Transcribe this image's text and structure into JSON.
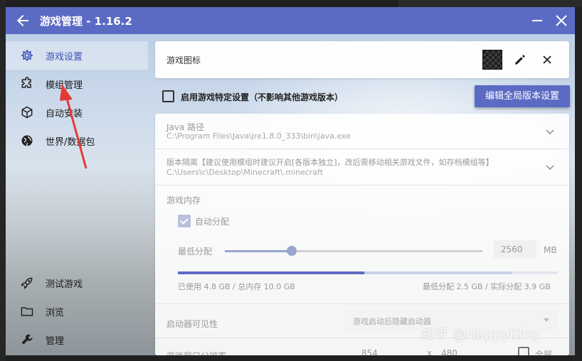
{
  "window": {
    "title": "游戏管理 - 1.16.2"
  },
  "sidebar": {
    "items": [
      {
        "label": "游戏设置",
        "icon": "gear-icon",
        "active": true
      },
      {
        "label": "模组管理",
        "icon": "puzzle-icon",
        "active": false
      },
      {
        "label": "自动安装",
        "icon": "package-icon",
        "active": false
      },
      {
        "label": "世界/数据包",
        "icon": "globe-icon",
        "active": false
      },
      {
        "label": "测试游戏",
        "icon": "rocket-icon",
        "active": false
      },
      {
        "label": "浏览",
        "icon": "folder-icon",
        "active": false
      },
      {
        "label": "管理",
        "icon": "wrench-icon",
        "active": false
      }
    ]
  },
  "icon_card": {
    "label": "游戏图标"
  },
  "specific_settings": {
    "label": "启用游戏特定设置（不影响其他游戏版本）",
    "checked": false
  },
  "global_button": {
    "label": "编辑全局版本设置"
  },
  "java": {
    "title": "Java 路径",
    "path": "C:\\Program Files\\Java\\jre1.8.0_333\\bin\\java.exe"
  },
  "isolation": {
    "title": "版本隔离【建议使用模组时建议开启[各版本独立]，改后需移动相关游戏文件，如存档模组等】",
    "path": "C:\\Users\\c\\Desktop\\Minecraft\\.minecraft"
  },
  "memory": {
    "title": "游戏内存",
    "auto_label": "自动分配",
    "auto_checked": true,
    "min_label": "最低分配",
    "value": "2560",
    "unit": "MB",
    "slider_fraction": 0.26,
    "used_fraction": 0.49,
    "alloc_fraction": 0.88,
    "used_text": "已使用 4.8 GB / 总内存 10.0 GB",
    "alloc_text": "最低分配 2.5 GB / 实际分配 3.9 GB"
  },
  "launcher_visibility": {
    "label": "启动器可见性",
    "value": "游戏启动后隐藏启动器"
  },
  "resolution": {
    "label": "游戏窗口分辨率",
    "width": "854",
    "x": "x",
    "height": "480",
    "fullscreen_label": "全屏"
  },
  "watermark": "知乎 @HappyKing",
  "colors": {
    "accent": "#5b6bc4",
    "annotation_arrow": "#e53935"
  }
}
